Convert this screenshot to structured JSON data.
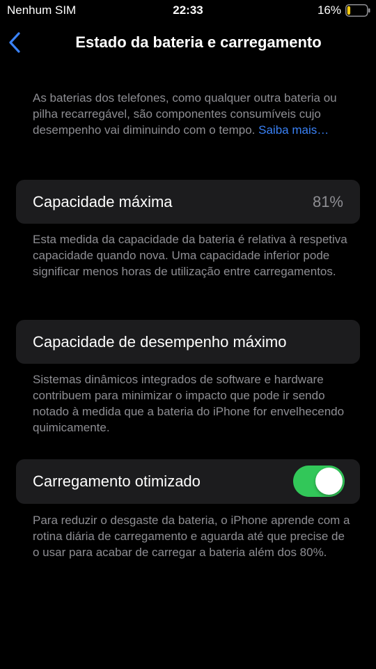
{
  "status_bar": {
    "carrier": "Nenhum SIM",
    "time": "22:33",
    "battery_percent": "16%",
    "battery_level": 0.16,
    "battery_color": "#f4c90f"
  },
  "nav": {
    "back_icon": "chevron-left-icon",
    "title": "Estado da bateria e carregamento"
  },
  "intro": {
    "text": "As baterias dos telefones, como qualquer outra bateria ou pilha recarregável, são componentes consumíveis cujo desempenho vai diminuindo com o tempo. ",
    "link": "Saiba mais…"
  },
  "max_capacity": {
    "label": "Capacidade máxima",
    "value": "81%",
    "description": "Esta medida da capacidade da bateria é relativa à respetiva capacidade quando nova. Uma capacidade inferior pode significar menos horas de utilização entre carregamentos."
  },
  "peak_performance": {
    "label": "Capacidade de desempenho máximo",
    "description": "Sistemas dinâmicos integrados de software e hardware contribuem para minimizar o impacto que pode ir sendo notado à medida que a bateria do iPhone for envelhecendo quimicamente."
  },
  "optimized_charging": {
    "label": "Carregamento otimizado",
    "enabled": true,
    "toggle_color": "#32c759",
    "description": "Para reduzir o desgaste da bateria, o iPhone aprende com a rotina diária de carregamento e aguarda até que precise de o usar para acabar de carregar a bateria além dos 80%."
  },
  "colors": {
    "background": "#000000",
    "card": "#1c1c1e",
    "secondary_text": "#8e8e93",
    "link": "#3a82f7"
  }
}
